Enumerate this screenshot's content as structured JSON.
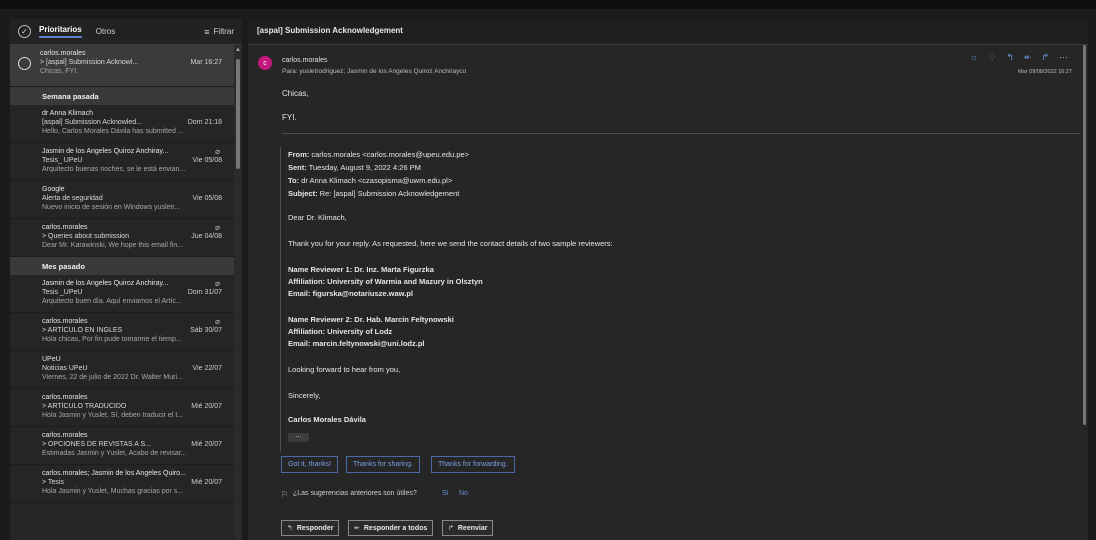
{
  "list": {
    "tabs": [
      "Prioritarios",
      "Otros"
    ],
    "filter_label": "Filtrar",
    "selected_mail": {
      "sender": "carlos.morales",
      "subject": "> [aspal] Submission Acknowl...",
      "date": "Mar 16:27",
      "preview": "Chicas, FYI."
    },
    "groups": [
      {
        "title": "Semana pasada",
        "mails": [
          {
            "sender": "dr Anna Klimach",
            "subject": "[aspal] Submission Acknowled...",
            "date": "Dom 21:18",
            "preview": "Hello, Carlos Morales Dávila has submitted ...",
            "clip": false
          },
          {
            "sender": "Jasmin de los Angeles Quiroz Anchiray...",
            "subject": "Tesis_ UPeU",
            "date": "Vie 05/08",
            "preview": "Arquitecto buenas noches, se le está envian...",
            "clip": true
          },
          {
            "sender": "Google",
            "subject": "Alerta de seguridad",
            "date": "Vie 05/08",
            "preview": "Nuevo inicio de sesión en Windows yusletr...",
            "clip": false
          },
          {
            "sender": "carlos.morales",
            "subject": "> Queries about submission",
            "date": "Jue 04/08",
            "preview": "Dear Mr. Karawinski, We hope this email fin...",
            "clip": true
          }
        ]
      },
      {
        "title": "Mes pasado",
        "mails": [
          {
            "sender": "Jasmin de los Angeles Quiroz Anchiray...",
            "subject": "Tesis _UPeU",
            "date": "Dom 31/07",
            "preview": "Arquitecto buen día. Aquí enviamos el Artíc...",
            "clip": true
          },
          {
            "sender": "carlos.morales",
            "subject": "> ARTÍCULO EN INGLES",
            "date": "Sáb 30/07",
            "preview": "Hola chicas, Por fin pude tomarme el tiemp...",
            "clip": true
          },
          {
            "sender": "UPeU",
            "subject": "Noticias UPeU",
            "date": "Vie 22/07",
            "preview": "Viernes, 22 de julio de 2022 Dr. Walter Muri...",
            "clip": false
          },
          {
            "sender": "carlos.morales",
            "subject": "> ARTÍCULO TRADUCIDO",
            "date": "Mié 20/07",
            "preview": "Hola Jasmin y Yuslet, Sí, deben traducir el t...",
            "clip": false
          },
          {
            "sender": "carlos.morales",
            "subject": "> OPCIONES DE REVISTAS A S...",
            "date": "Mié 20/07",
            "preview": "Estimadas Jasmin y Yuslet, Acabo de revisar...",
            "clip": false
          },
          {
            "sender": "carlos.morales; Jasmin de los Angeles Quiro...",
            "subject": "> Tesis",
            "date": "Mié 20/07",
            "preview": "Hola Jasmin y Yuslet, Muchas gracias por s...",
            "clip": false
          }
        ]
      }
    ]
  },
  "message": {
    "subject": "[aspal] Submission Acknowledgement",
    "avatar_letter": "c",
    "sender": "carlos.morales",
    "recipients": "Para: yusletrodriguez; Jasmin de los Angeles Quiroz Anchirayco",
    "date": "Mar 09/08/2022 16:27",
    "greeting": "Chicas,",
    "fyi": "FYI.",
    "quote": {
      "from_label": "From:",
      "from": "carlos.morales <carlos.morales@upeu.edu.pe>",
      "sent_label": "Sent:",
      "sent": "Tuesday, August 9, 2022 4:26 PM",
      "to_label": "To:",
      "to": "dr Anna Klimach <czasopisma@uwm.edu.pl>",
      "subject_label": "Subject:",
      "subject": "Re: [aspal] Submission Acknowledgement",
      "salutation": "Dear Dr. Klimach,",
      "intro": "Thank you for your reply. As requested, here we send the contact details of two sample reviewers:",
      "r1_name": "Name Reviewer 1: Dr. Inz. Marta Figurzka",
      "r1_aff": "Affiliation: University of Warmia and Mazury in Olsztyn",
      "r1_email": "Email: figurska@notariusze.waw.pl",
      "r2_name": "Name Reviewer 2: Dr. Hab. Marcin Feltynowski",
      "r2_aff": "Affiliation: University of Lodz",
      "r2_email": "Email: marcin.feltynowski@uni.lodz.pl",
      "closing": "Looking forward to hear from you,",
      "sincerely": "Sincerely,",
      "signature": "Carlos Morales Dávila"
    },
    "expand_dots": "...",
    "quick_replies": [
      "Got it, thanks!",
      "Thanks for sharing.",
      "Thanks for forwarding."
    ],
    "suggest_question": "¿Las sugerencias anteriores son útiles?",
    "suggest_yes": "Sí",
    "suggest_no": "No",
    "buttons": {
      "reply": "Responder",
      "reply_all": "Responder a todos",
      "forward": "Reenviar"
    }
  },
  "colors": {
    "accent": "#6b8fd6",
    "avatar": "#c2187b",
    "selected_row": "#3b3b3b",
    "group_header": "#3a3a3a"
  }
}
